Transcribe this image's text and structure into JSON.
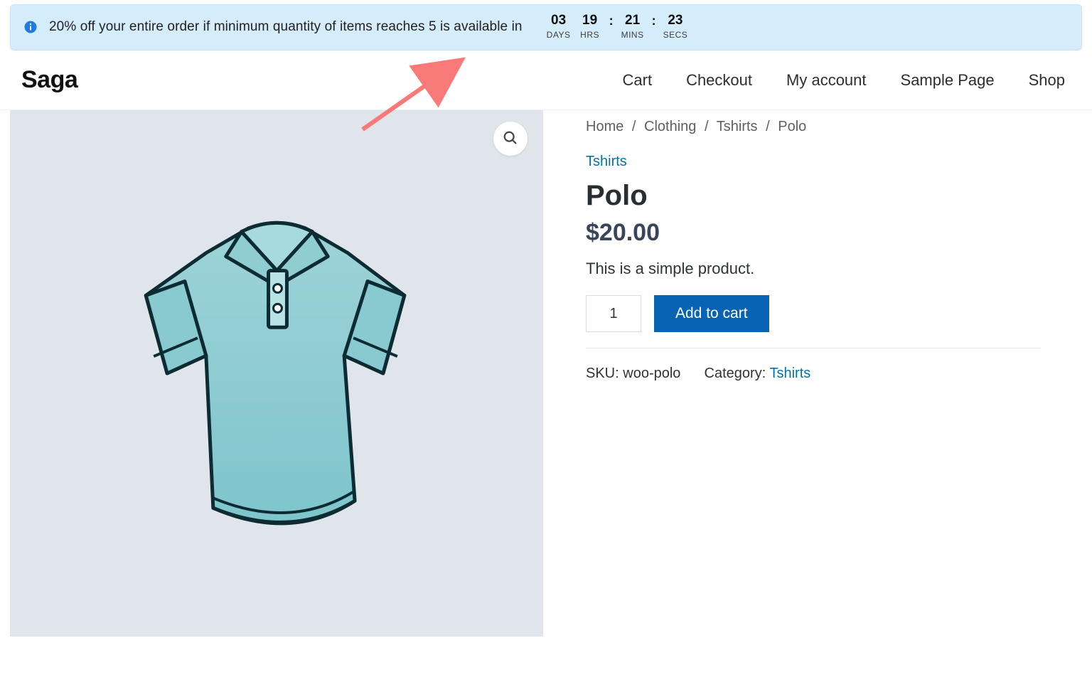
{
  "promo": {
    "message": "20% off your entire order if minimum quantity of items reaches 5 is available in",
    "countdown": {
      "days": {
        "value": "03",
        "label": "DAYS"
      },
      "hours": {
        "value": "19",
        "label": "HRS"
      },
      "mins": {
        "value": "21",
        "label": "MINS"
      },
      "secs": {
        "value": "23",
        "label": "SECS"
      }
    }
  },
  "header": {
    "brand": "Saga",
    "nav": {
      "cart": "Cart",
      "checkout": "Checkout",
      "account": "My account",
      "sample": "Sample Page",
      "shop": "Shop"
    }
  },
  "breadcrumb": {
    "home": "Home",
    "clothing": "Clothing",
    "tshirts": "Tshirts",
    "current": "Polo",
    "sep": "/"
  },
  "product": {
    "category_link": "Tshirts",
    "title": "Polo",
    "price": "$20.00",
    "short_desc": "This is a simple product.",
    "qty_value": "1",
    "add_to_cart": "Add to cart"
  },
  "meta": {
    "sku_label": "SKU:",
    "sku_value": "woo-polo",
    "category_label": "Category:",
    "category_value": "Tshirts"
  }
}
